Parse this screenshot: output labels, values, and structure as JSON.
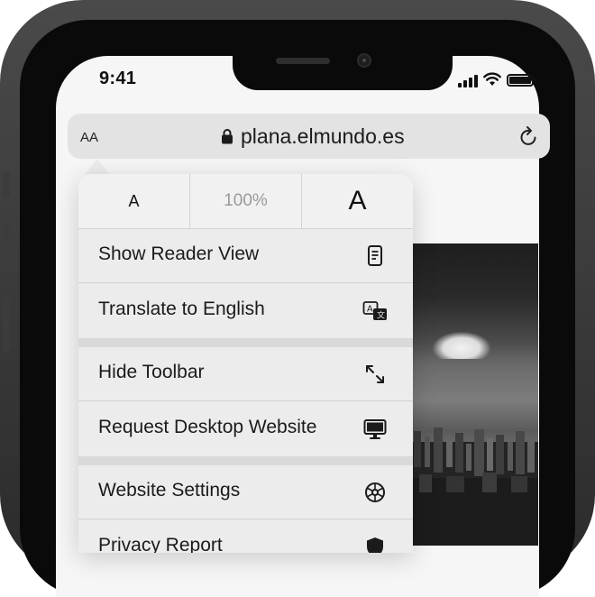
{
  "status_bar": {
    "time": "9:41",
    "icons": [
      "signal-icon",
      "wifi-icon",
      "battery-icon"
    ]
  },
  "address_bar": {
    "text_size_button": "AA",
    "url": "plana.elmundo.es",
    "icons": [
      "lock-icon",
      "reload-icon"
    ]
  },
  "popover": {
    "font_size": {
      "decrease_label": "A",
      "zoom_level": "100%",
      "increase_label": "A"
    },
    "items": [
      {
        "label": "Show Reader View",
        "icon": "reader-view-icon"
      },
      {
        "label": "Translate to English",
        "icon": "translate-icon"
      },
      {
        "label": "Hide Toolbar",
        "icon": "expand-arrows-icon"
      },
      {
        "label": "Request Desktop Website",
        "icon": "desktop-monitor-icon"
      },
      {
        "label": "Website Settings",
        "icon": "settings-gear-icon"
      },
      {
        "label": "Privacy Report",
        "icon": "privacy-shield-icon"
      }
    ]
  },
  "colors": {
    "text_primary": "#1b1b1b",
    "menu_background": "#ececec",
    "address_bar_background": "#e3e3e3",
    "frame": "#2b2b2b"
  }
}
